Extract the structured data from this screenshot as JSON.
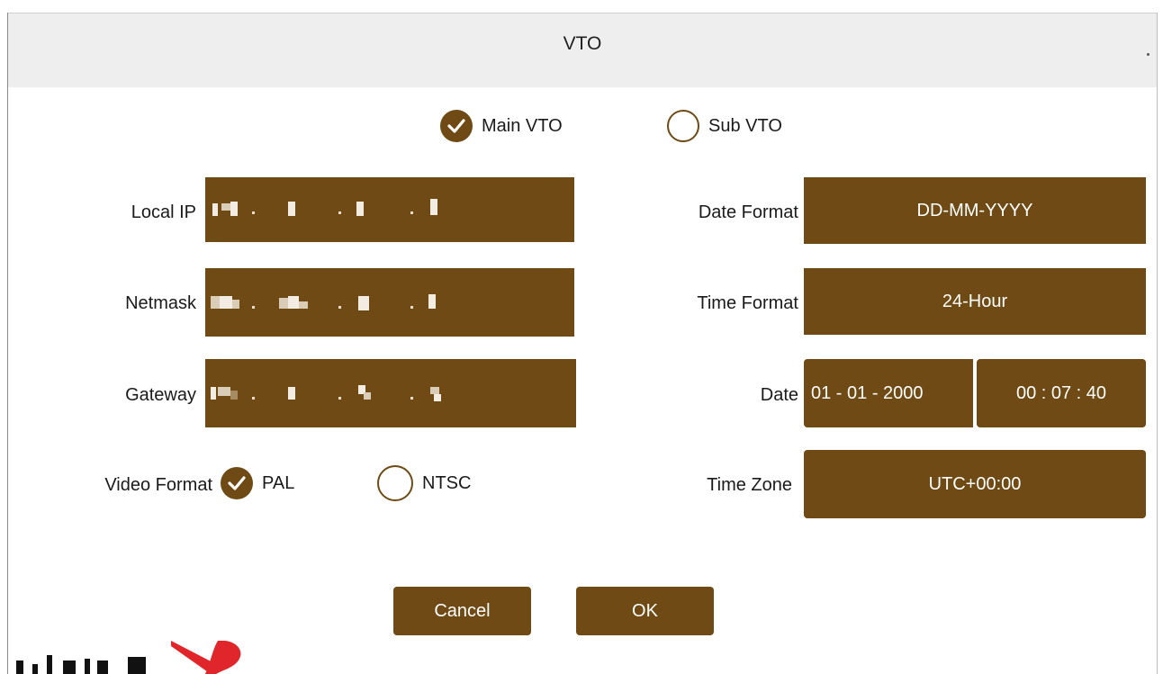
{
  "dialog": {
    "title": "VTO"
  },
  "role": {
    "options": [
      {
        "label": "Main VTO",
        "selected": true
      },
      {
        "label": "Sub VTO",
        "selected": false
      }
    ]
  },
  "network": {
    "local_ip_label": "Local IP",
    "netmask_label": "Netmask",
    "gateway_label": "Gateway"
  },
  "video": {
    "label": "Video Format",
    "options": [
      {
        "label": "PAL",
        "selected": true
      },
      {
        "label": "NTSC",
        "selected": false
      }
    ]
  },
  "datetime": {
    "date_format_label": "Date Format",
    "date_format_value": "DD-MM-YYYY",
    "time_format_label": "Time Format",
    "time_format_value": "24-Hour",
    "date_label": "Date",
    "date_value": "01 - 01 - 2000",
    "time_value": "00 : 07 : 40",
    "time_zone_label": "Time Zone",
    "time_zone_value": "UTC+00:00"
  },
  "buttons": {
    "cancel": "Cancel",
    "ok": "OK"
  },
  "colors": {
    "accent": "#6f4a14",
    "titlebar": "#eeeeee"
  }
}
